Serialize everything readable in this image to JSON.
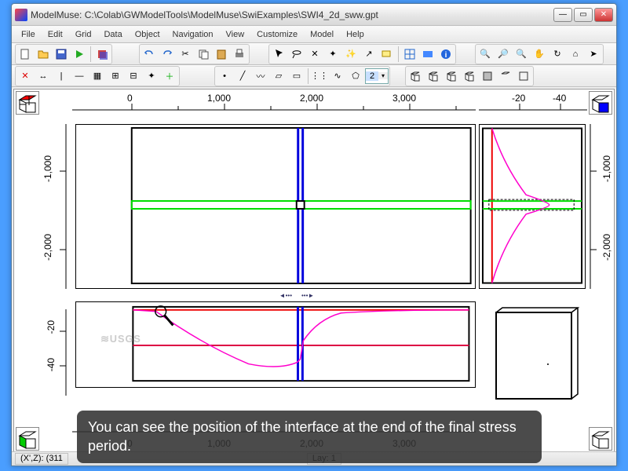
{
  "window": {
    "title": "ModelMuse: C:\\Colab\\GWModelTools\\ModelMuse\\SwiExamples\\SWI4_2d_sww.gpt"
  },
  "menu": {
    "items": [
      "File",
      "Edit",
      "Grid",
      "Data",
      "Object",
      "Navigation",
      "View",
      "Customize",
      "Model",
      "Help"
    ]
  },
  "toolbar2": {
    "spinner_value": "2"
  },
  "ruler_top_main": {
    "ticks": [
      "0",
      "1,000",
      "2,000",
      "3,000"
    ]
  },
  "ruler_top_right": {
    "ticks": [
      "-20",
      "-40"
    ]
  },
  "ruler_left_upper": {
    "ticks": [
      "-1,000",
      "-2,000"
    ]
  },
  "ruler_left_lower": {
    "ticks": [
      "-20",
      "-40"
    ]
  },
  "ruler_right_upper": {
    "ticks": [
      "-1,000",
      "-2,000"
    ]
  },
  "ruler_bottom": {
    "ticks": [
      "0",
      "1,000",
      "2,000",
      "3,000"
    ]
  },
  "status": {
    "coord_label": "(X',Z): (311",
    "layer": "Lay: 1"
  },
  "overlay": {
    "caption": "You can see the position of the interface at the end of the final stress period."
  },
  "watermark": "USGS",
  "chart_data": [
    {
      "type": "scatter",
      "view": "top (X,Y)",
      "xlim": [
        0,
        4000
      ],
      "ylim": [
        -2500,
        0
      ],
      "domain_box": {
        "xmin": 0,
        "xmax": 4000,
        "ymin": 0,
        "ymax": -2500
      },
      "green_zone_y": [
        -1150,
        -1250
      ],
      "blue_column_x": [
        1990,
        2010
      ],
      "center_marker": {
        "x": 2000,
        "y": -1200
      }
    },
    {
      "type": "line",
      "view": "side-right (Z,Y)",
      "xlim": [
        -50,
        0
      ],
      "ylim": [
        -2500,
        0
      ],
      "red_vertical_x": -5,
      "green_zone_y": [
        -1150,
        -1250
      ],
      "magenta_curve": {
        "x": [
          -5,
          -8,
          -18,
          -35,
          -35,
          -18,
          -8,
          -5
        ],
        "y": [
          0,
          -400,
          -900,
          -1150,
          -1250,
          -1500,
          -2000,
          -2500
        ]
      }
    },
    {
      "type": "line",
      "view": "front (X,Z)",
      "xlim": [
        0,
        4000
      ],
      "ylim": [
        -50,
        0
      ],
      "red_horizontal_z": -5,
      "magenta_horizontal_z": -25,
      "blue_column_x": [
        1990,
        2010
      ],
      "interface_curve": {
        "x": [
          0,
          300,
          800,
          1400,
          1900,
          2000,
          2100,
          2300,
          2600,
          3000,
          3500,
          4000
        ],
        "z": [
          -5,
          -7,
          -28,
          -40,
          -42,
          -38,
          -22,
          -8,
          -6,
          -5,
          -5,
          -5
        ]
      },
      "magnifier_marker": {
        "x": 300,
        "z": -7
      }
    },
    {
      "type": "other",
      "view": "3d-placeholder",
      "box": {
        "xmin": 0,
        "xmax": 1,
        "ymin": 0,
        "ymax": 1,
        "zmin": 0,
        "zmax": 1
      }
    }
  ]
}
